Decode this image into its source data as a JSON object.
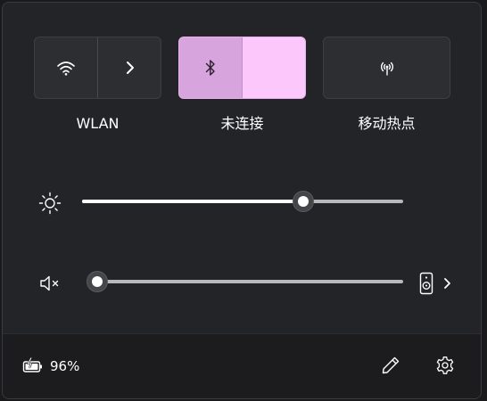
{
  "tiles": {
    "wifi": {
      "label": "WLAN",
      "icon": "wifi-icon",
      "expand_icon": "chevron-right-icon"
    },
    "bluetooth": {
      "label": "未连接",
      "icon": "bluetooth-icon",
      "active": true
    },
    "hotspot": {
      "label": "移动热点",
      "icon": "hotspot-icon"
    }
  },
  "brightness": {
    "icon": "sun-icon",
    "value": 0.69
  },
  "volume": {
    "icon": "speaker-muted-icon",
    "value": 0.03,
    "output_icon": "speaker-device-icon",
    "expand_icon": "chevron-right-icon"
  },
  "footer": {
    "battery": {
      "icon": "battery-charging-icon",
      "percent": "96%"
    },
    "edit_icon": "pencil-icon",
    "settings_icon": "gear-icon"
  },
  "colors": {
    "accent": "#fcc8fc",
    "accent_dark": "#d7a4dd",
    "panel": "#232427",
    "footer": "#1c1c1e"
  }
}
